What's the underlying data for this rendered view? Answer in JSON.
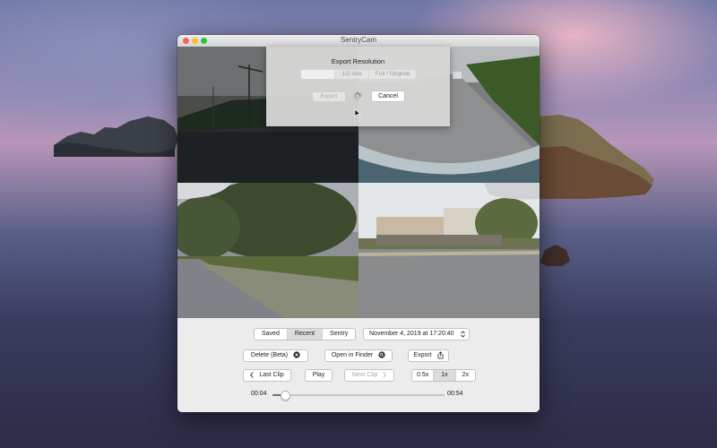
{
  "window": {
    "title": "SentryCam"
  },
  "source_tabs": [
    {
      "label": "Saved",
      "selected": false
    },
    {
      "label": "Recent",
      "selected": true
    },
    {
      "label": "Sentry",
      "selected": false
    }
  ],
  "date_select": {
    "value": "November 4, 2019 at 17:20:40"
  },
  "actions": {
    "delete_label": "Delete (Beta)",
    "open_finder_label": "Open in Finder",
    "export_label": "Export"
  },
  "nav": {
    "last_clip_label": "Last Clip",
    "play_label": "Play",
    "next_clip_label": "Next Clip"
  },
  "speed": [
    {
      "label": "0.5x",
      "selected": false
    },
    {
      "label": "1x",
      "selected": true
    },
    {
      "label": "2x",
      "selected": false
    }
  ],
  "timeline": {
    "current": "00:04",
    "total": "00:54",
    "progress": 0.074
  },
  "export_dialog": {
    "title": "Export Resolution",
    "options": [
      {
        "label": "",
        "selected": true
      },
      {
        "label": "1/2 size",
        "selected": false
      },
      {
        "label": "Full / Original",
        "selected": false
      }
    ],
    "export_label": "Export",
    "cancel_label": "Cancel"
  },
  "colors": {
    "close": "#fe5f57",
    "minimize": "#febc2e",
    "zoom": "#28c840"
  }
}
